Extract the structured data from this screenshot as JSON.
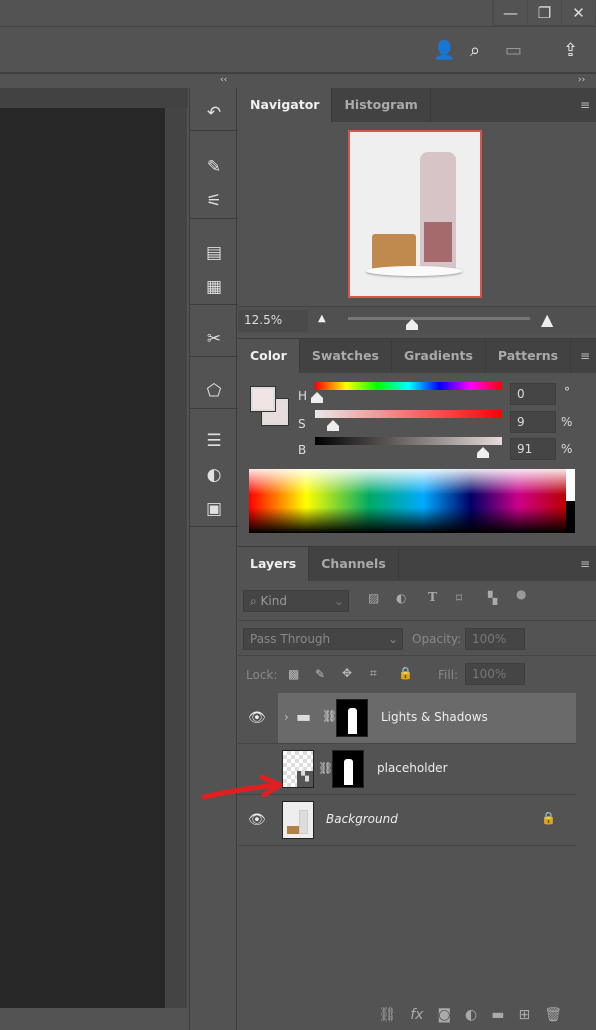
{
  "window": {
    "controls": {
      "minimize": "—",
      "restore": "❐",
      "close": "✕"
    }
  },
  "options_bar": {
    "icons": [
      "share-account-icon",
      "search-icon",
      "workspace-icon",
      "share-icon"
    ]
  },
  "dock": {
    "collapse": "‹‹",
    "expand": "››"
  },
  "navigator": {
    "tabs": [
      {
        "label": "Navigator",
        "active": true
      },
      {
        "label": "Histogram",
        "active": false
      }
    ],
    "zoom": "12.5%",
    "zoom_slider_fraction": 0.4
  },
  "color": {
    "tabs": [
      {
        "label": "Color",
        "active": true
      },
      {
        "label": "Swatches"
      },
      {
        "label": "Gradients"
      },
      {
        "label": "Patterns"
      }
    ],
    "foreground": "#f0e4e4",
    "background": "#e8dcdc",
    "sliders": [
      {
        "label": "H",
        "value": "0",
        "unit": "°"
      },
      {
        "label": "S",
        "value": "9",
        "unit": "%"
      },
      {
        "label": "B",
        "value": "91",
        "unit": "%"
      }
    ]
  },
  "layers": {
    "tabs": [
      {
        "label": "Layers",
        "active": true
      },
      {
        "label": "Channels"
      }
    ],
    "filter": "Kind",
    "blend_mode": "Pass Through",
    "opacity_label": "Opacity:",
    "opacity": "100%",
    "lock_label": "Lock:",
    "fill_label": "Fill:",
    "fill": "100%",
    "items": [
      {
        "name": "Lights & Shadows",
        "type": "group",
        "selected": true
      },
      {
        "name": "placeholder",
        "type": "smart-object"
      },
      {
        "name": "Background",
        "type": "background",
        "locked": true
      }
    ],
    "annotation_color": "#e02020"
  }
}
